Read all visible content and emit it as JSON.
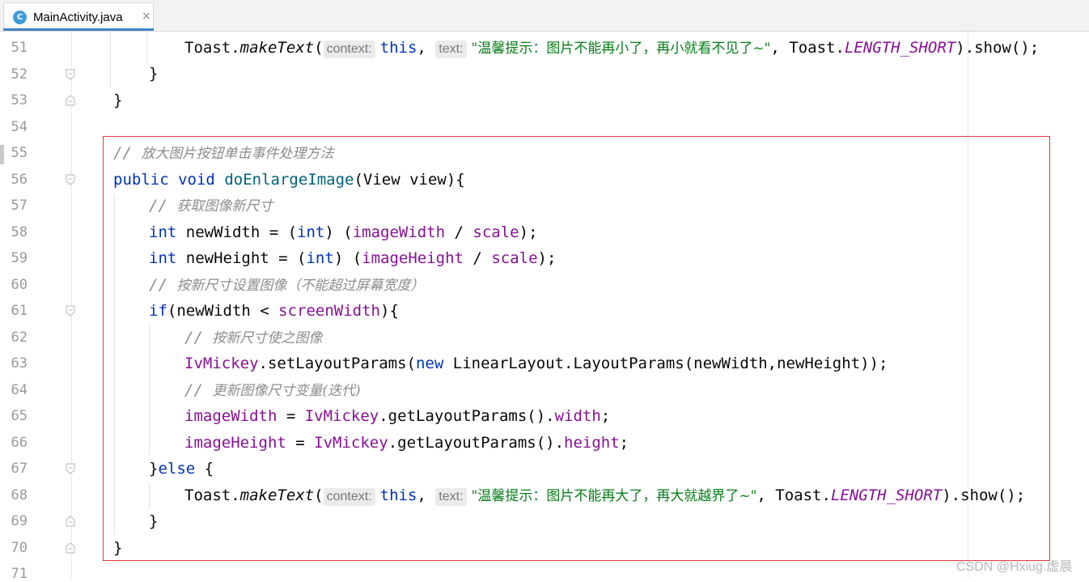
{
  "editor": {
    "tab": {
      "icon": "java-class-icon",
      "icon_letter": "C",
      "label": "MainActivity.java",
      "close_glyph": "×"
    },
    "hints": {
      "context": "context:",
      "text": "text:"
    },
    "lines": [
      {
        "num": "51",
        "tokens": {
          "t1": "Toast.",
          "t2": "makeText",
          "t3": "(",
          "t4": "this",
          "t5": ", ",
          "t6": "\"温馨提示：图片不能再小了，再小就看不见了~\"",
          "t7": ", Toast.",
          "t8": "LENGTH_SHORT",
          "t9": ").show();"
        }
      },
      {
        "num": "52",
        "text": "}"
      },
      {
        "num": "53",
        "text": "}"
      },
      {
        "num": "54",
        "text": ""
      },
      {
        "num": "55",
        "slash": "// ",
        "comment": "放大图片按钮单击事件处理方法"
      },
      {
        "num": "56",
        "tokens": {
          "t1": "public",
          "t2": " ",
          "t3": "void",
          "t4": " ",
          "t5": "doEnlargeImage",
          "t6": "(View view){"
        }
      },
      {
        "num": "57",
        "slash": "// ",
        "comment": "获取图像新尺寸"
      },
      {
        "num": "58",
        "tokens": {
          "t1": "int",
          "t2": " newWidth = (",
          "t3": "int",
          "t4": ") (",
          "t5": "imageWidth",
          "t6": " / ",
          "t7": "scale",
          "t8": ");"
        }
      },
      {
        "num": "59",
        "tokens": {
          "t1": "int",
          "t2": " newHeight = (",
          "t3": "int",
          "t4": ") (",
          "t5": "imageHeight",
          "t6": " / ",
          "t7": "scale",
          "t8": ");"
        }
      },
      {
        "num": "60",
        "slash": "// ",
        "comment": "按新尺寸设置图像（不能超过屏幕宽度）"
      },
      {
        "num": "61",
        "tokens": {
          "t1": "if",
          "t2": "(newWidth < ",
          "t3": "screenWidth",
          "t4": "){"
        }
      },
      {
        "num": "62",
        "slash": "// ",
        "comment": "按新尺寸使之图像"
      },
      {
        "num": "63",
        "tokens": {
          "t1": "IvMickey",
          "t2": ".setLayoutParams(",
          "t3": "new",
          "t4": " LinearLayout.LayoutParams(newWidth,newHeight));"
        }
      },
      {
        "num": "64",
        "slash": "// ",
        "comment": "更新图像尺寸变量(迭代)"
      },
      {
        "num": "65",
        "tokens": {
          "t1": "imageWidth",
          "t2": " = ",
          "t3": "IvMickey",
          "t4": ".getLayoutParams().",
          "t5": "width",
          "t6": ";"
        }
      },
      {
        "num": "66",
        "tokens": {
          "t1": "imageHeight",
          "t2": " = ",
          "t3": "IvMickey",
          "t4": ".getLayoutParams().",
          "t5": "height",
          "t6": ";"
        }
      },
      {
        "num": "67",
        "tokens": {
          "t1": "}",
          "t2": "else",
          "t3": " {"
        }
      },
      {
        "num": "68",
        "tokens": {
          "t1": "Toast.",
          "t2": "makeText",
          "t3": "(",
          "t4": "this",
          "t5": ", ",
          "t6": "\"温馨提示：图片不能再大了，再大就越界了~\"",
          "t7": ", Toast.",
          "t8": "LENGTH_SHORT",
          "t9": ").show();"
        }
      },
      {
        "num": "69",
        "text": "}"
      },
      {
        "num": "70",
        "text": "}"
      },
      {
        "num": "71",
        "text": ""
      }
    ]
  },
  "watermark": "CSDN @Hxiug.虚晨",
  "colors": {
    "keyword": "#0033b3",
    "method": "#00627a",
    "field": "#871094",
    "string": "#067d17",
    "comment": "#8c8c8c",
    "highlight_border": "#e03b3b"
  }
}
